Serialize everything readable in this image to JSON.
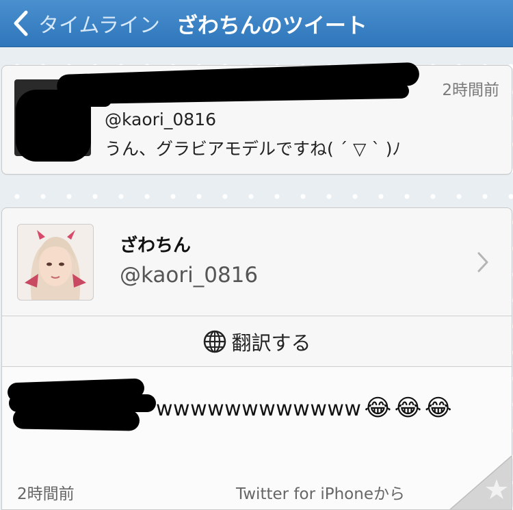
{
  "nav": {
    "back_label": "タイムライン",
    "title": "ざわちんのツイート"
  },
  "reply_tweet": {
    "time": "2時間前",
    "handle": "@kaori_0816",
    "text": "うん、グラビアモデルですね( ´ ▽ ` )ﾉ"
  },
  "main_tweet": {
    "display_name": "ざわちん",
    "handle": "@kaori_0816",
    "translate_label": "翻訳する",
    "text": "wwwwwwwwwwww",
    "emojis": [
      "😂",
      "😂",
      "😂"
    ],
    "time": "2時間前",
    "via": "Twitter for iPhoneから"
  },
  "colors": {
    "nav_top": "#4a90cf",
    "nav_bottom": "#2f76bb",
    "background": "#e9eef3",
    "card": "#f7f7f7"
  },
  "icons": [
    "chevron-left-icon",
    "globe-icon",
    "chevron-right-icon",
    "star-icon"
  ]
}
